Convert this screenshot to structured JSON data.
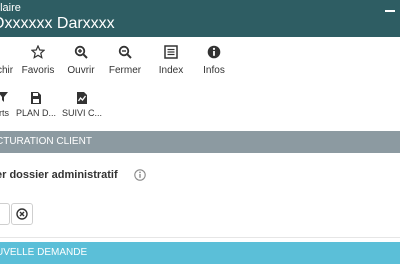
{
  "header": {
    "subtitle": "ulaire",
    "title": "Oxxxxxx Darxxxx"
  },
  "toolbar_primary": [
    {
      "label": "chir",
      "icon": "folder-icon"
    },
    {
      "label": "Favoris",
      "icon": "star-icon"
    },
    {
      "label": "Ouvrir",
      "icon": "zoom-in-icon"
    },
    {
      "label": "Fermer",
      "icon": "zoom-out-icon"
    },
    {
      "label": "Index",
      "icon": "index-list-icon"
    },
    {
      "label": "Infos",
      "icon": "info-icon"
    }
  ],
  "toolbar_secondary": [
    {
      "label": "rts",
      "icon": "filter-icon"
    },
    {
      "label": "PLAN D...",
      "icon": "save-document-icon"
    },
    {
      "label": "SUIVI C...",
      "icon": "document-chart-icon"
    }
  ],
  "section_billing": {
    "label": "CTURATION CLIENT"
  },
  "field": {
    "label": "er dossier administratif"
  },
  "section_new_request": {
    "label": "UVELLE DEMANDE"
  },
  "colors": {
    "header_bg": "#2e5d63",
    "section_gray": "#8c9aa1",
    "section_blue": "#5bbfd8"
  }
}
